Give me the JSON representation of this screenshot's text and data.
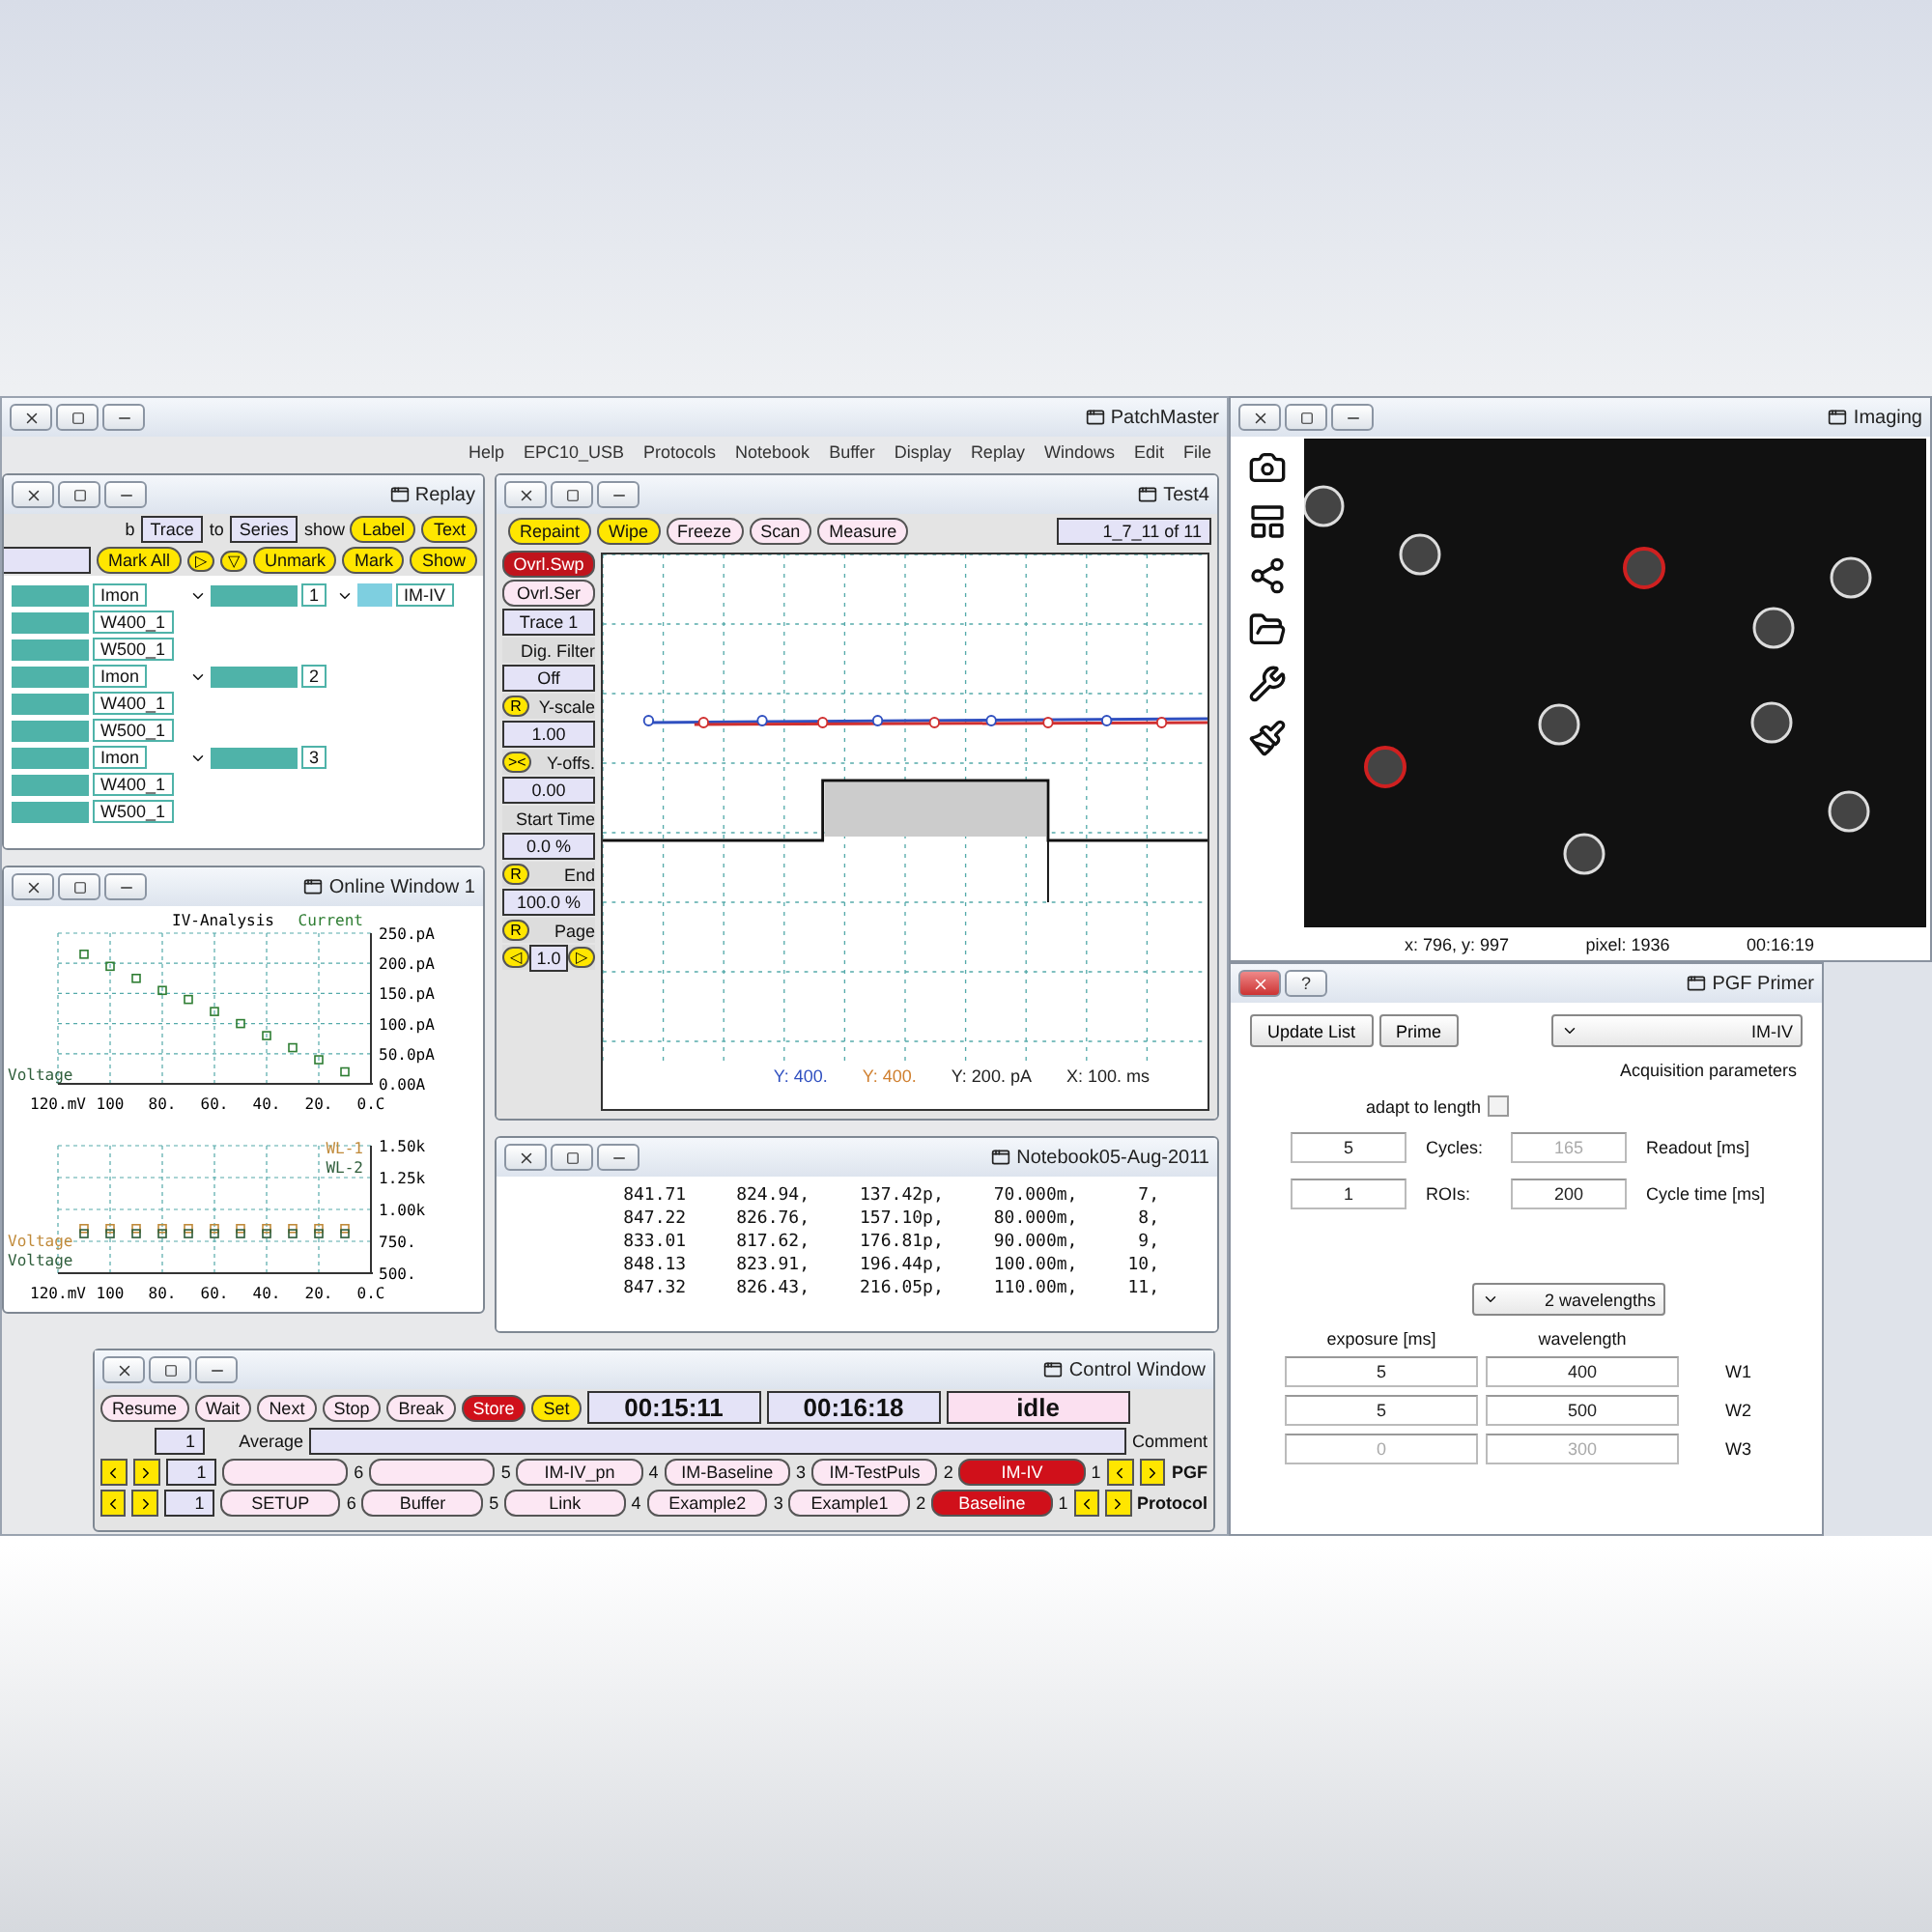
{
  "main_window": {
    "title": "PatchMaster",
    "menu": [
      "Help",
      "EPC10_USB",
      "Protocols",
      "Notebook",
      "Buffer",
      "Display",
      "Replay",
      "Windows",
      "Edit",
      "File"
    ]
  },
  "replay": {
    "title": "Replay",
    "row1": [
      {
        "kind": "text",
        "label": "b"
      },
      {
        "kind": "field",
        "label": "Trace"
      },
      {
        "kind": "text",
        "label": "to"
      },
      {
        "kind": "field",
        "label": "Series"
      },
      {
        "kind": "text",
        "label": "show"
      },
      {
        "kind": "button",
        "label": "Label"
      },
      {
        "kind": "button",
        "label": "Text"
      }
    ],
    "row2": [
      {
        "kind": "field"
      },
      {
        "kind": "button",
        "label": "Mark All"
      },
      {
        "kind": "arrow",
        "label": "▷"
      },
      {
        "kind": "arrow",
        "label": "▽"
      },
      {
        "kind": "button",
        "label": "Unmark"
      },
      {
        "kind": "button",
        "label": "Mark"
      },
      {
        "kind": "button",
        "label": "Show"
      }
    ],
    "tree": [
      {
        "label": "IM-IV",
        "expanded": true,
        "children": [
          {
            "label": "1",
            "expanded": true,
            "children": [
              {
                "label": "Imon"
              },
              {
                "label": "W400_1"
              },
              {
                "label": "W500_1"
              }
            ]
          },
          {
            "label": "2",
            "expanded": true,
            "children": [
              {
                "label": "Imon"
              },
              {
                "label": "W400_1"
              },
              {
                "label": "W500_1"
              }
            ]
          },
          {
            "label": "3",
            "expanded": true,
            "children": [
              {
                "label": "Imon"
              },
              {
                "label": "W400_1"
              },
              {
                "label": "W500_1"
              }
            ]
          }
        ]
      }
    ]
  },
  "online_window": {
    "title": "Online Window 1",
    "charts": [
      {
        "chart_data": {
          "type": "scatter",
          "title": "IV-Analysis",
          "xlabel": "Voltage",
          "x": [
            10,
            20,
            30,
            40,
            50,
            60,
            70,
            80,
            90,
            100,
            110
          ],
          "series": [
            {
              "name": "Current",
              "color": "#2e7d32",
              "values": [
                20,
                40,
                60,
                80,
                100,
                120,
                140,
                155,
                175,
                195,
                215
              ]
            }
          ],
          "grid": true,
          "xlim": [
            120,
            0
          ],
          "ylim": [
            0,
            250
          ],
          "xticks": [
            {
              "value": 0,
              "label": "0.C"
            },
            {
              "value": 20,
              "label": "20."
            },
            {
              "value": 40,
              "label": "40."
            },
            {
              "value": 60,
              "label": "60."
            },
            {
              "value": 80,
              "label": "80."
            },
            {
              "value": 100,
              "label": "100"
            },
            {
              "value": 120,
              "label": "120.mV"
            }
          ],
          "yticks": [
            {
              "value": 0,
              "label": "0.00A"
            },
            {
              "value": 50,
              "label": "50.0pA"
            },
            {
              "value": 100,
              "label": "100.pA"
            },
            {
              "value": 150,
              "label": "150.pA"
            },
            {
              "value": 200,
              "label": "200.pA"
            },
            {
              "value": 250,
              "label": "250.pA"
            }
          ]
        }
      },
      {
        "chart_data": {
          "type": "scatter",
          "xlabel": "Voltage",
          "x": [
            10,
            20,
            30,
            40,
            50,
            60,
            70,
            80,
            90,
            100,
            110
          ],
          "series": [
            {
              "name": "WL-1",
              "color": "#c08a3a",
              "values": [
                850,
                850,
                850,
                850,
                850,
                850,
                850,
                850,
                850,
                850,
                850
              ]
            },
            {
              "name": "WL-2",
              "color": "#2e5d3a",
              "values": [
                810,
                810,
                810,
                810,
                810,
                810,
                810,
                810,
                810,
                810,
                810
              ]
            }
          ],
          "grid": true,
          "xlim": [
            120,
            0
          ],
          "ylim": [
            500,
            1500
          ],
          "xticks": [
            {
              "value": 0,
              "label": "0.C"
            },
            {
              "value": 20,
              "label": "20."
            },
            {
              "value": 40,
              "label": "40."
            },
            {
              "value": 60,
              "label": "60."
            },
            {
              "value": 80,
              "label": "80."
            },
            {
              "value": 100,
              "label": "100"
            },
            {
              "value": 120,
              "label": "120.mV"
            }
          ],
          "yticks": [
            {
              "value": 500,
              "label": "500."
            },
            {
              "value": 750,
              "label": "750."
            },
            {
              "value": 1000,
              "label": "1.00k"
            },
            {
              "value": 1250,
              "label": "1.25k"
            },
            {
              "value": 1500,
              "label": "1.50k"
            }
          ]
        }
      }
    ]
  },
  "test_window": {
    "title": "Test4",
    "toolbar": [
      {
        "kind": "yellow",
        "label": "Repaint"
      },
      {
        "kind": "yellow",
        "label": "Wipe"
      },
      {
        "kind": "plain",
        "label": "Freeze"
      },
      {
        "kind": "plain",
        "label": "Scan"
      },
      {
        "kind": "plain",
        "label": "Measure"
      }
    ],
    "position": "1_7_11 of 11",
    "side": [
      {
        "kind": "button",
        "label": "Ovrl.Swp",
        "on": true
      },
      {
        "kind": "button",
        "label": "Ovrl.Ser",
        "on": false
      },
      {
        "kind": "field",
        "label": "Trace 1"
      },
      {
        "kind": "label",
        "label": "Dig. Filter"
      },
      {
        "kind": "field",
        "label": "Off"
      },
      {
        "kind": "label",
        "label": "Y-scale",
        "button": "R"
      },
      {
        "kind": "field",
        "label": "1.00"
      },
      {
        "kind": "label",
        "label": "Y-offs.",
        "button": "><"
      },
      {
        "kind": "field",
        "label": "0.00"
      },
      {
        "kind": "label",
        "label": "Start Time"
      },
      {
        "kind": "field",
        "label": "0.0 %"
      },
      {
        "kind": "label",
        "label": "End",
        "button": "R"
      },
      {
        "kind": "field",
        "label": "100.0 %"
      },
      {
        "kind": "label",
        "label": "Page",
        "button": "R"
      },
      {
        "kind": "pager",
        "label": "1.0",
        "prev": "◁",
        "next": "▷"
      }
    ],
    "scales": [
      {
        "label": "Y: 400.",
        "color": "#3050c0"
      },
      {
        "label": "Y: 400.",
        "color": "#d08030"
      },
      {
        "label": "Y: 200. pA",
        "color": "#222222"
      },
      {
        "label": "X: 100. ms",
        "color": "#222222"
      }
    ]
  },
  "notebook": {
    "title": "Notebook05-Aug-2011",
    "rows": [
      [
        "841.71",
        "824.94,",
        "137.42p,",
        "70.000m,",
        "7,"
      ],
      [
        "847.22",
        "826.76,",
        "157.10p,",
        "80.000m,",
        "8,"
      ],
      [
        "833.01",
        "817.62,",
        "176.81p,",
        "90.000m,",
        "9,"
      ],
      [
        "848.13",
        "823.91,",
        "196.44p,",
        "100.00m,",
        "10,"
      ],
      [
        "847.32",
        "826.43,",
        "216.05p,",
        "110.00m,",
        "11,"
      ]
    ]
  },
  "control_window": {
    "title": "Control Window",
    "buttons": [
      {
        "kind": "plain",
        "label": "Resume",
        "on": false
      },
      {
        "kind": "plain",
        "label": "Wait",
        "on": false
      },
      {
        "kind": "plain",
        "label": "Next",
        "on": false
      },
      {
        "kind": "plain",
        "label": "Stop",
        "on": false
      },
      {
        "kind": "plain",
        "label": "Break",
        "on": false
      },
      {
        "kind": "plain",
        "label": "Store",
        "on": true
      },
      {
        "kind": "yellow",
        "label": "Set",
        "on": false
      }
    ],
    "timer": "00:15:11",
    "time": "00:16:18",
    "status": "idle",
    "average": "1",
    "average_label": "Average",
    "comment_label": "Comment",
    "lists": [
      {
        "label": "PGF",
        "count": "1",
        "slots": [
          {
            "number": "6",
            "selected": false
          },
          {
            "number": "5",
            "selected": false
          },
          {
            "number": "4",
            "name": "IM-IV_pn",
            "selected": false
          },
          {
            "number": "3",
            "name": "IM-Baseline",
            "selected": false
          },
          {
            "number": "2",
            "name": "IM-TestPuls",
            "selected": false
          },
          {
            "number": "1",
            "name": "IM-IV",
            "selected": true
          }
        ]
      },
      {
        "label": "Protocol",
        "count": "1",
        "slots": [
          {
            "number": "6",
            "name": "SETUP",
            "selected": false
          },
          {
            "number": "5",
            "name": "Buffer",
            "selected": false
          },
          {
            "number": "4",
            "name": "Link",
            "selected": false
          },
          {
            "number": "3",
            "name": "Example2",
            "selected": false
          },
          {
            "number": "2",
            "name": "Example1",
            "selected": false
          },
          {
            "number": "1",
            "name": "Baseline",
            "selected": true
          }
        ]
      }
    ]
  },
  "imaging": {
    "title": "Imaging",
    "status": [
      "x: 796, y: 997",
      "pixel: 1936",
      "00:16:19"
    ]
  },
  "pgf_primer": {
    "title": "PGF Primer",
    "help": "?",
    "sequence": "IM-IV",
    "prime": "Prime",
    "update": "Update List",
    "section": "Acquisition parameters",
    "adapt": {
      "label": "adapt to length",
      "checked": false
    },
    "params": [
      {
        "label": "Readout [ms]",
        "value": "165",
        "disabled": true,
        "label2": "Cycles:",
        "value2": "5"
      },
      {
        "label": "Cycle time [ms]",
        "value": "200",
        "disabled": false,
        "label2": "ROIs:",
        "value2": "1"
      }
    ],
    "wavelength_mode": "2 wavelengths",
    "columns": [
      "exposure [ms]",
      "wavelength"
    ],
    "rows": [
      {
        "name": "W1",
        "wavelength": "400",
        "exposure": "5",
        "disabled": false
      },
      {
        "name": "W2",
        "wavelength": "500",
        "exposure": "5",
        "disabled": false
      },
      {
        "name": "W3",
        "wavelength": "300",
        "exposure": "0",
        "disabled": true
      }
    ]
  }
}
